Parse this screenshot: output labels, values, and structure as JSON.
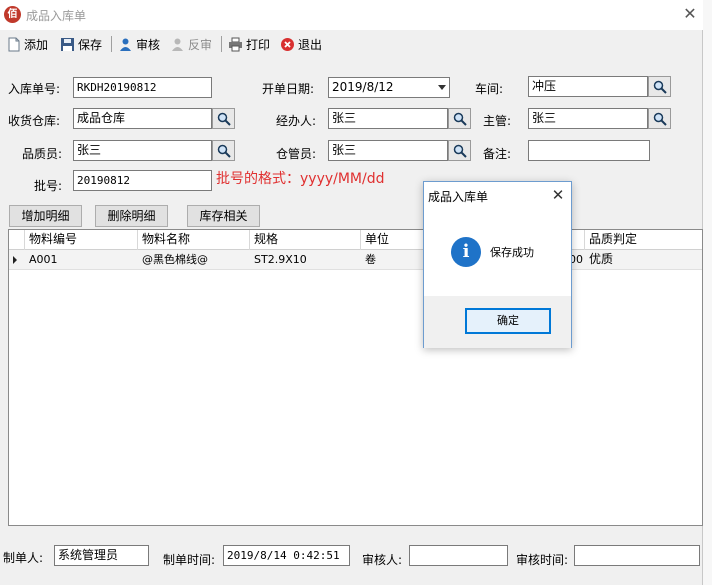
{
  "window": {
    "title": "成品入库单",
    "app_icon_char": "佰"
  },
  "toolbar": {
    "add": "添加",
    "save": "保存",
    "audit": "审核",
    "unaudit": "反审",
    "print": "打印",
    "exit": "退出"
  },
  "form": {
    "receipt_no": {
      "label": "入库单号:",
      "value": "RKDH20190812"
    },
    "open_date": {
      "label": "开单日期:",
      "value": "2019/8/12"
    },
    "workshop": {
      "label": "车间:",
      "value": "冲压"
    },
    "warehouse": {
      "label": "收货仓库:",
      "value": "成品仓库"
    },
    "handler": {
      "label": "经办人:",
      "value": "张三"
    },
    "supervisor": {
      "label": "主管:",
      "value": "张三"
    },
    "qc": {
      "label": "品质员:",
      "value": "张三"
    },
    "keeper": {
      "label": "仓管员:",
      "value": "张三"
    },
    "remark": {
      "label": "备注:",
      "value": ""
    },
    "batch": {
      "label": "批号:",
      "value": "20190812"
    },
    "batch_hint": "批号的格式：yyyy/MM/dd"
  },
  "buttons": {
    "add_detail": "增加明细",
    "delete_detail": "删除明细",
    "stock": "库存相关"
  },
  "grid": {
    "columns": [
      "物料编号",
      "物料名称",
      "规格",
      "单位",
      "品质判定"
    ],
    "rows": [
      {
        "code": "A001",
        "name": "@黑色棉线@",
        "spec": "ST2.9X10",
        "unit": "卷",
        "hidden_tail": "00",
        "quality": "优质"
      }
    ]
  },
  "footer": {
    "maker": {
      "label": "制单人:",
      "value": "系统管理员"
    },
    "make_time": {
      "label": "制单时间:",
      "value": "2019/8/14 0:42:51"
    },
    "auditor": {
      "label": "审核人:",
      "value": ""
    },
    "audit_time": {
      "label": "审核时间:",
      "value": ""
    }
  },
  "dialog": {
    "title": "成品入库单",
    "message": "保存成功",
    "ok": "确定",
    "icon_char": "i"
  },
  "colors": {
    "hint_red": "#e03030",
    "info_blue": "#1f73c8",
    "accent": "#0078d7"
  }
}
